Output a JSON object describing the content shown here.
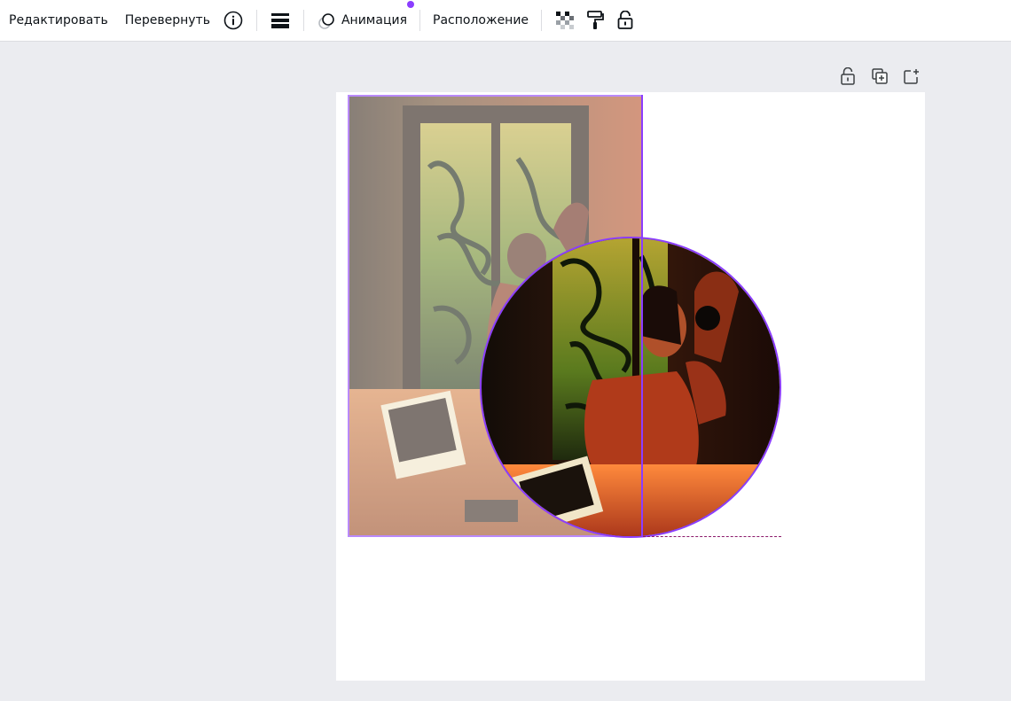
{
  "toolbar": {
    "edit_label": "Редактировать",
    "flip_label": "Перевернуть",
    "info_icon": "info-icon",
    "border_style_icon": "border-style-icon",
    "animate_label": "Анимация",
    "animate_icon": "animate-icon",
    "position_label": "Расположение",
    "transparency_icon": "transparency-icon",
    "copy_style_icon": "paint-roller-icon",
    "lock_icon": "lock-icon",
    "accent_color": "#8b3dff"
  },
  "canvas_actions": {
    "lock_icon": "lock-icon",
    "duplicate_icon": "duplicate-page-icon",
    "add_page_icon": "add-page-icon"
  },
  "canvas": {
    "selection_color": "#8b3dff",
    "guide_color": "#8b1a6b"
  }
}
